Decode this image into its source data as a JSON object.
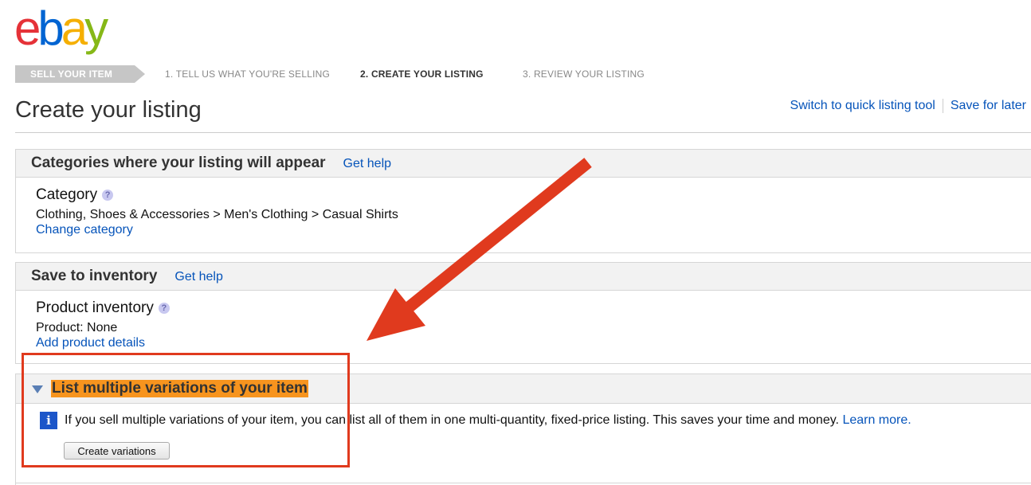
{
  "brand": {
    "logo_letters": [
      "e",
      "b",
      "a",
      "y"
    ],
    "logo_colors": [
      "#e53238",
      "#0064d2",
      "#f5af02",
      "#86b817"
    ]
  },
  "steps": [
    {
      "label": "SELL YOUR ITEM",
      "state": "badge"
    },
    {
      "label": "1. TELL US WHAT YOU'RE SELLING",
      "state": "inactive"
    },
    {
      "label": "2. CREATE YOUR LISTING",
      "state": "current"
    },
    {
      "label": "3. REVIEW YOUR LISTING",
      "state": "inactive"
    }
  ],
  "page": {
    "title": "Create your listing"
  },
  "top_links": {
    "quick_tool": "Switch to quick listing tool",
    "save_later": "Save for later"
  },
  "categories_panel": {
    "title": "Categories where your listing will appear",
    "help": "Get help",
    "field_label": "Category",
    "path": "Clothing, Shoes & Accessories > Men's Clothing > Casual Shirts",
    "change_link": "Change category"
  },
  "inventory_panel": {
    "title": "Save to inventory",
    "help": "Get help",
    "field_label": "Product inventory",
    "product": "Product: None",
    "add_link": "Add product details"
  },
  "variations_panel": {
    "title": "List multiple variations of your item",
    "info_icon_letter": "i",
    "info_text": "If you sell multiple variations of your item, you can list all of them in one multi-quantity, fixed-price listing. This saves your time and money.",
    "learn_more": "Learn more.",
    "button": "Create variations"
  },
  "colors": {
    "link": "#0654ba",
    "highlight": "#f7941e",
    "annotation": "#e03a1e"
  }
}
